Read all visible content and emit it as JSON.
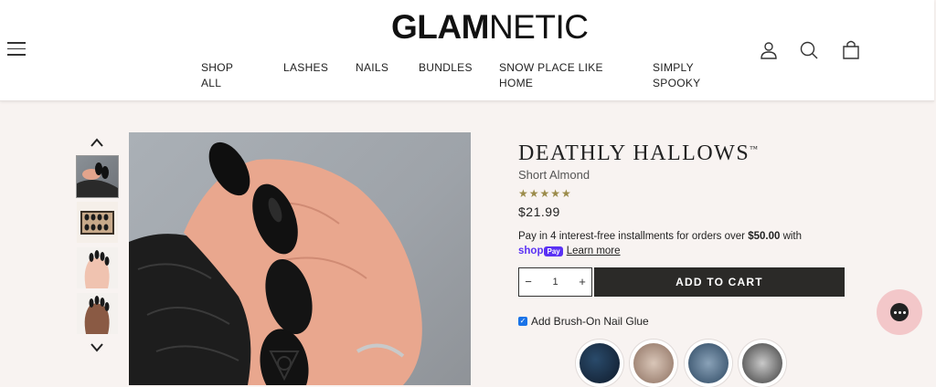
{
  "header": {
    "logo_bold": "GLAM",
    "logo_light": "NETIC",
    "nav": [
      {
        "line1": "SHOP",
        "line2": "ALL"
      },
      {
        "line1": "LASHES",
        "line2": ""
      },
      {
        "line1": "NAILS",
        "line2": ""
      },
      {
        "line1": "BUNDLES",
        "line2": ""
      },
      {
        "line1": "SNOW PLACE LIKE",
        "line2": "HOME"
      },
      {
        "line1": "SIMPLY",
        "line2": "SPOOKY"
      }
    ],
    "icons": [
      "menu-icon",
      "account-icon",
      "search-icon",
      "cart-icon"
    ]
  },
  "product": {
    "title": "DEATHLY HALLOWS",
    "trademark": "™",
    "variant": "Short Almond",
    "stars": "★★★★★",
    "price": "$21.99",
    "installments_text": "Pay in 4 interest-free installments for orders over ",
    "installments_amount": "$50.00",
    "installments_suffix": " with",
    "shop_label": "shop",
    "pay_label": "Pay",
    "learn_more": "Learn more",
    "qty_minus": "−",
    "qty_value": "1",
    "qty_plus": "+",
    "add_to_cart": "ADD TO CART",
    "glue_label": "Add Brush-On Nail Glue",
    "glue_checked": true
  },
  "colors": {
    "page_bg": "#f8f3f1",
    "button_dark": "#2b2a28",
    "star_gold": "#9b8b4a",
    "shoppay_purple": "#5a31f4",
    "chat_pink": "#f3c7c9"
  }
}
